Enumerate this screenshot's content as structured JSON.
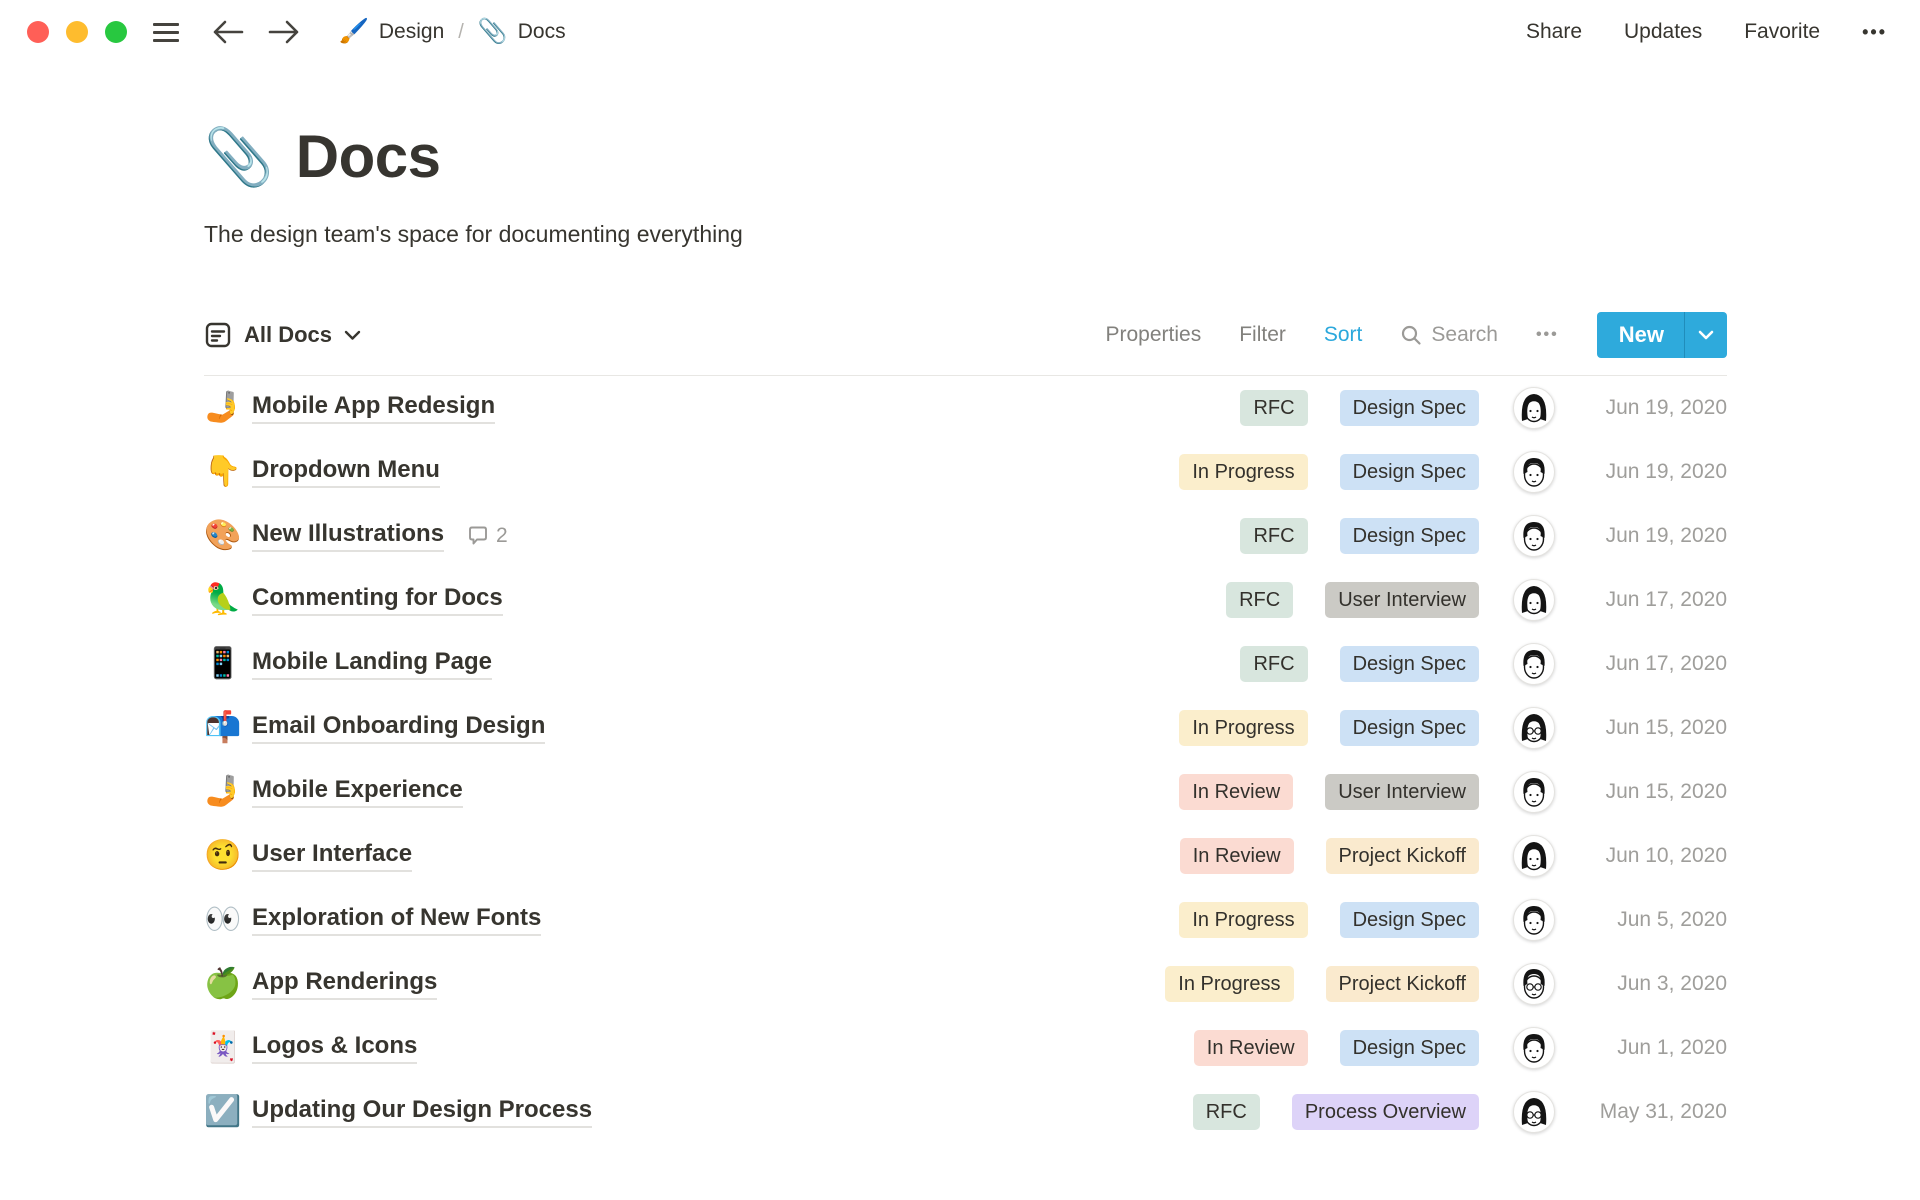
{
  "topbar": {
    "breadcrumb": [
      {
        "icon_emoji": "🖌️",
        "label": "Design"
      },
      {
        "icon_emoji": "📎",
        "label": "Docs"
      }
    ],
    "separator": "/",
    "actions": {
      "share": "Share",
      "updates": "Updates",
      "favorite": "Favorite",
      "more": "•••"
    }
  },
  "page": {
    "icon_emoji": "📎",
    "title": "Docs",
    "description": "The design team's space for documenting everything"
  },
  "toolbar": {
    "view_label": "All Docs",
    "properties": "Properties",
    "filter": "Filter",
    "sort": "Sort",
    "search": "Search",
    "more": "•••",
    "new_label": "New"
  },
  "colors": {
    "accent_blue": "#2eaadc",
    "sort_active": "#2ba8dc",
    "tag_green": "#d8e6de",
    "tag_yellow": "#fbeecc",
    "tag_orange": "#faeace",
    "tag_red": "#fbdbd2",
    "tag_blue": "#cde1f5",
    "tag_gray": "#cbcac5",
    "tag_purple": "#ddd3f8",
    "date_gray": "#9f9e9b"
  },
  "table": {
    "rows": [
      {
        "icon": "🤳",
        "title": "Mobile App Redesign",
        "status": "RFC",
        "status_bg": "#d8e6de",
        "type": "Design Spec",
        "type_bg": "#cde1f5",
        "avatar": "woman",
        "date": "Jun 19, 2020"
      },
      {
        "icon": "👇",
        "title": "Dropdown Menu",
        "status": "In Progress",
        "status_bg": "#fbeecc",
        "type": "Design Spec",
        "type_bg": "#cde1f5",
        "avatar": "man",
        "date": "Jun 19, 2020"
      },
      {
        "icon": "🎨",
        "title": "New Illustrations",
        "comments_count": "2",
        "status": "RFC",
        "status_bg": "#d8e6de",
        "type": "Design Spec",
        "type_bg": "#cde1f5",
        "avatar": "man",
        "date": "Jun 19, 2020"
      },
      {
        "icon": "🦜",
        "title": "Commenting for Docs",
        "status": "RFC",
        "status_bg": "#d8e6de",
        "type": "User Interview",
        "type_bg": "#cbcac5",
        "avatar": "woman",
        "date": "Jun 17, 2020"
      },
      {
        "icon": "📱",
        "title": "Mobile Landing Page",
        "status": "RFC",
        "status_bg": "#d8e6de",
        "type": "Design Spec",
        "type_bg": "#cde1f5",
        "avatar": "man",
        "date": "Jun 17, 2020"
      },
      {
        "icon": "📬",
        "title": "Email Onboarding Design",
        "status": "In Progress",
        "status_bg": "#fbeecc",
        "type": "Design Spec",
        "type_bg": "#cde1f5",
        "avatar": "woman-glasses",
        "date": "Jun 15, 2020"
      },
      {
        "icon": "🤳",
        "title": "Mobile Experience",
        "status": "In Review",
        "status_bg": "#fbdbd2",
        "type": "User Interview",
        "type_bg": "#cbcac5",
        "avatar": "man",
        "date": "Jun 15, 2020"
      },
      {
        "icon": "🤨",
        "title": "User Interface",
        "status": "In Review",
        "status_bg": "#fbdbd2",
        "type": "Project Kickoff",
        "type_bg": "#faeace",
        "avatar": "woman",
        "date": "Jun 10, 2020"
      },
      {
        "icon": "👀",
        "title": "Exploration of New Fonts",
        "status": "In Progress",
        "status_bg": "#fbeecc",
        "type": "Design Spec",
        "type_bg": "#cde1f5",
        "avatar": "man",
        "date": "Jun 5, 2020"
      },
      {
        "icon": "🍏",
        "title": "App Renderings",
        "status": "In Progress",
        "status_bg": "#fbeecc",
        "type": "Project Kickoff",
        "type_bg": "#faeace",
        "avatar": "man-glasses",
        "date": "Jun 3, 2020"
      },
      {
        "icon": "🃏",
        "title": "Logos & Icons",
        "status": "In Review",
        "status_bg": "#fbdbd2",
        "type": "Design Spec",
        "type_bg": "#cde1f5",
        "avatar": "man",
        "date": "Jun 1, 2020"
      },
      {
        "icon": "☑️",
        "title": "Updating Our Design Process",
        "status": "RFC",
        "status_bg": "#d8e6de",
        "type": "Process Overview",
        "type_bg": "#ddd3f8",
        "avatar": "woman-glasses",
        "date": "May 31, 2020"
      }
    ]
  }
}
